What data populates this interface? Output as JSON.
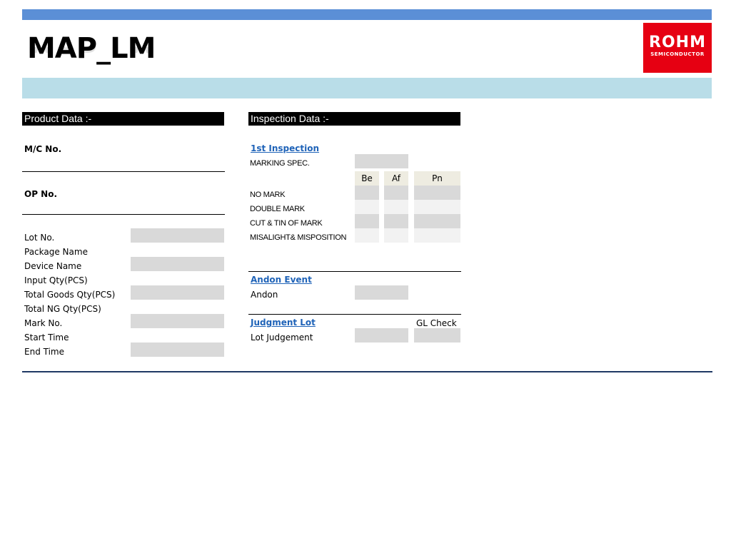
{
  "header": {
    "title": "MAP_LM",
    "logo_brand": "ROHM",
    "logo_sub": "SEMICONDUCTOR"
  },
  "product": {
    "heading": "Product Data :-",
    "mc_label": "M/C No.",
    "op_label": "OP  No.",
    "fields": [
      {
        "label": "Lot  No.",
        "value": ""
      },
      {
        "label": "Package Name",
        "value": ""
      },
      {
        "label": "Device Name",
        "value": ""
      },
      {
        "label": "Input Qty(PCS)",
        "value": ""
      },
      {
        "label": "Total Goods Qty(PCS)",
        "value": ""
      },
      {
        "label": "Total NG Qty(PCS)",
        "value": ""
      },
      {
        "label": "Mark No.",
        "value": ""
      },
      {
        "label": "Start Time",
        "value": ""
      },
      {
        "label": "End Time",
        "value": ""
      }
    ]
  },
  "inspection": {
    "heading": "Inspection Data  :-",
    "first_link": "1st Inspection",
    "marking_spec_label": "MARKING SPEC.",
    "col_be": "Be",
    "col_af": "Af",
    "col_pn": "Pn",
    "rows": [
      {
        "label": "NO MARK"
      },
      {
        "label": "DOUBLE MARK"
      },
      {
        "label": "CUT & TIN OF MARK"
      },
      {
        "label": "MISALIGHT& MISPOSITION"
      }
    ],
    "andon_link": "Andon Event",
    "andon_label": "Andon",
    "judgment_link": "Judgment Lot",
    "gl_check_label": "GL Check",
    "lot_judgement_label": "Lot Judgement"
  },
  "colors": {
    "top_bar": "#5b8fd6",
    "sub_bar": "#b9dde8",
    "logo_red": "#e60012",
    "link_blue": "#1f63b8"
  }
}
